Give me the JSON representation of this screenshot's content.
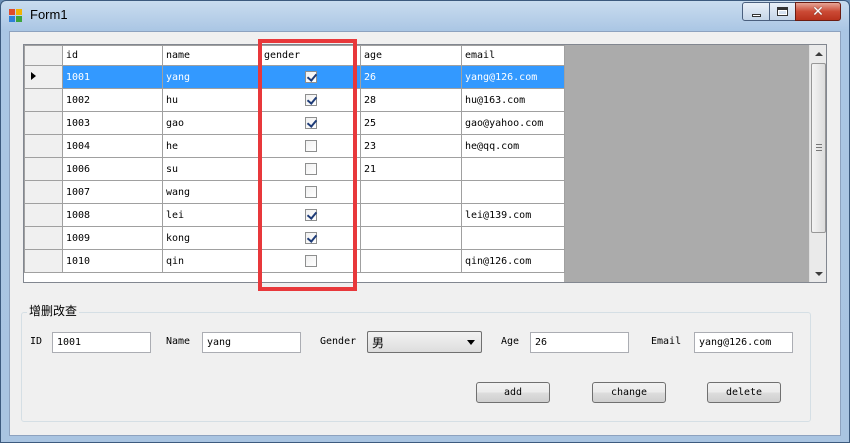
{
  "window": {
    "title": "Form1"
  },
  "colors": {
    "selection": "#3399ff",
    "highlight_box": "#e8383b",
    "grid_empty": "#ababab"
  },
  "grid": {
    "columns": [
      "id",
      "name",
      "gender",
      "age",
      "email"
    ],
    "rows": [
      {
        "id": "1001",
        "name": "yang",
        "gender": true,
        "age": "26",
        "email": "yang@126.com",
        "selected": true
      },
      {
        "id": "1002",
        "name": "hu",
        "gender": true,
        "age": "28",
        "email": "hu@163.com"
      },
      {
        "id": "1003",
        "name": "gao",
        "gender": true,
        "age": "25",
        "email": "gao@yahoo.com"
      },
      {
        "id": "1004",
        "name": "he",
        "gender": false,
        "age": "23",
        "email": "he@qq.com"
      },
      {
        "id": "1006",
        "name": "su",
        "gender": false,
        "age": "21",
        "email": ""
      },
      {
        "id": "1007",
        "name": "wang",
        "gender": false,
        "age": "",
        "email": ""
      },
      {
        "id": "1008",
        "name": "lei",
        "gender": true,
        "age": "",
        "email": "lei@139.com"
      },
      {
        "id": "1009",
        "name": "kong",
        "gender": true,
        "age": "",
        "email": ""
      },
      {
        "id": "1010",
        "name": "qin",
        "gender": false,
        "age": "",
        "email": "qin@126.com"
      }
    ],
    "row_pointer_icon": "triangle-right-icon"
  },
  "form": {
    "group_title": "增删改查",
    "labels": {
      "id": "ID",
      "name": "Name",
      "gender": "Gender",
      "age": "Age",
      "email": "Email"
    },
    "values": {
      "id": "1001",
      "name": "yang",
      "gender": "男",
      "age": "26",
      "email": "yang@126.com"
    },
    "buttons": {
      "add": "add",
      "change": "change",
      "delete": "delete"
    }
  }
}
